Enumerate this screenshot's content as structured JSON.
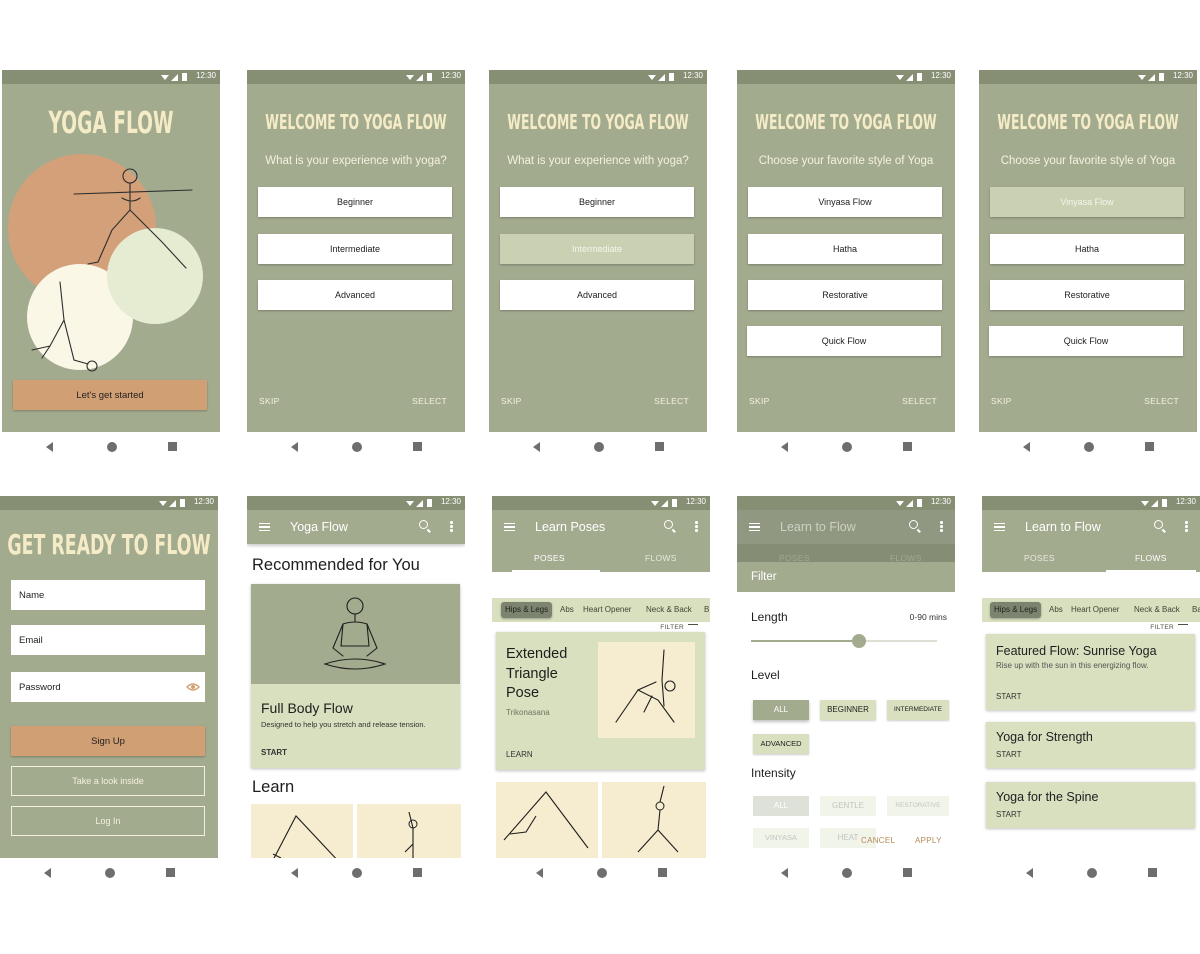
{
  "status_time": "12:30",
  "colors": {
    "sage": "#a3ab8f",
    "status": "#868f74",
    "peach": "#d19f74",
    "cream": "#f5ecc7",
    "card": "#d8e0bf"
  },
  "splash": {
    "title": "YOGA FLOW",
    "cta": "Let's get started"
  },
  "onboarding": {
    "title": "WELCOME TO YOGA FLOW",
    "experience_question": "What is your experience with yoga?",
    "experience_options": [
      "Beginner",
      "Intermediate",
      "Advanced"
    ],
    "style_question": "Choose your favorite style of Yoga",
    "style_options": [
      "Vinyasa Flow",
      "Hatha",
      "Restorative",
      "Quick Flow"
    ],
    "skip": "SKIP",
    "select": "SELECT"
  },
  "signup": {
    "title": "GET READY TO FLOW",
    "name_placeholder": "Name",
    "email_placeholder": "Email",
    "password_placeholder": "Password",
    "sign_up": "Sign Up",
    "take_look": "Take a look inside",
    "log_in": "Log In"
  },
  "home": {
    "app_title": "Yoga Flow",
    "recommended_heading": "Recommended for You",
    "card_title": "Full Body Flow",
    "card_desc": "Designed to help you stretch and release tension.",
    "card_action": "START",
    "learn_heading": "Learn"
  },
  "learn_poses": {
    "app_title": "Learn Poses",
    "tabs": [
      "POSES",
      "FLOWS"
    ],
    "chips": [
      "Hips & Legs",
      "Abs",
      "Heart Opener",
      "Neck & Back",
      "B"
    ],
    "filter": "FILTER",
    "pose_title_lines": [
      "Extended",
      "Triangle",
      "Pose"
    ],
    "pose_sanskrit": "Trikonasana",
    "pose_action": "LEARN"
  },
  "filter_sheet": {
    "app_title": "Learn to Flow",
    "tabs": [
      "POSES",
      "FLOWS"
    ],
    "sheet_title": "Filter",
    "length_label": "Length",
    "length_range": "0-90 mins",
    "slider_value": 0.58,
    "level_label": "Level",
    "level_options": [
      "ALL",
      "BEGINNER",
      "INTERMEDIATE",
      "ADVANCED"
    ],
    "intensity_label": "Intensity",
    "intensity_options": [
      "ALL",
      "GENTLE",
      "RESTORATIVE",
      "VINYASA",
      "HEAT"
    ],
    "cancel": "CANCEL",
    "apply": "APPLY"
  },
  "learn_flows": {
    "app_title": "Learn to Flow",
    "tabs": [
      "POSES",
      "FLOWS"
    ],
    "chips": [
      "Hips & Legs",
      "Abs",
      "Heart Opener",
      "Neck & Back",
      "Ba"
    ],
    "filter": "FILTER",
    "cards": [
      {
        "title": "Featured Flow: Sunrise Yoga",
        "desc": "Rise up with the sun in this energizing flow.",
        "action": "START"
      },
      {
        "title": "Yoga for Strength",
        "action": "START"
      },
      {
        "title": "Yoga for the Spine",
        "action": "START"
      }
    ]
  }
}
